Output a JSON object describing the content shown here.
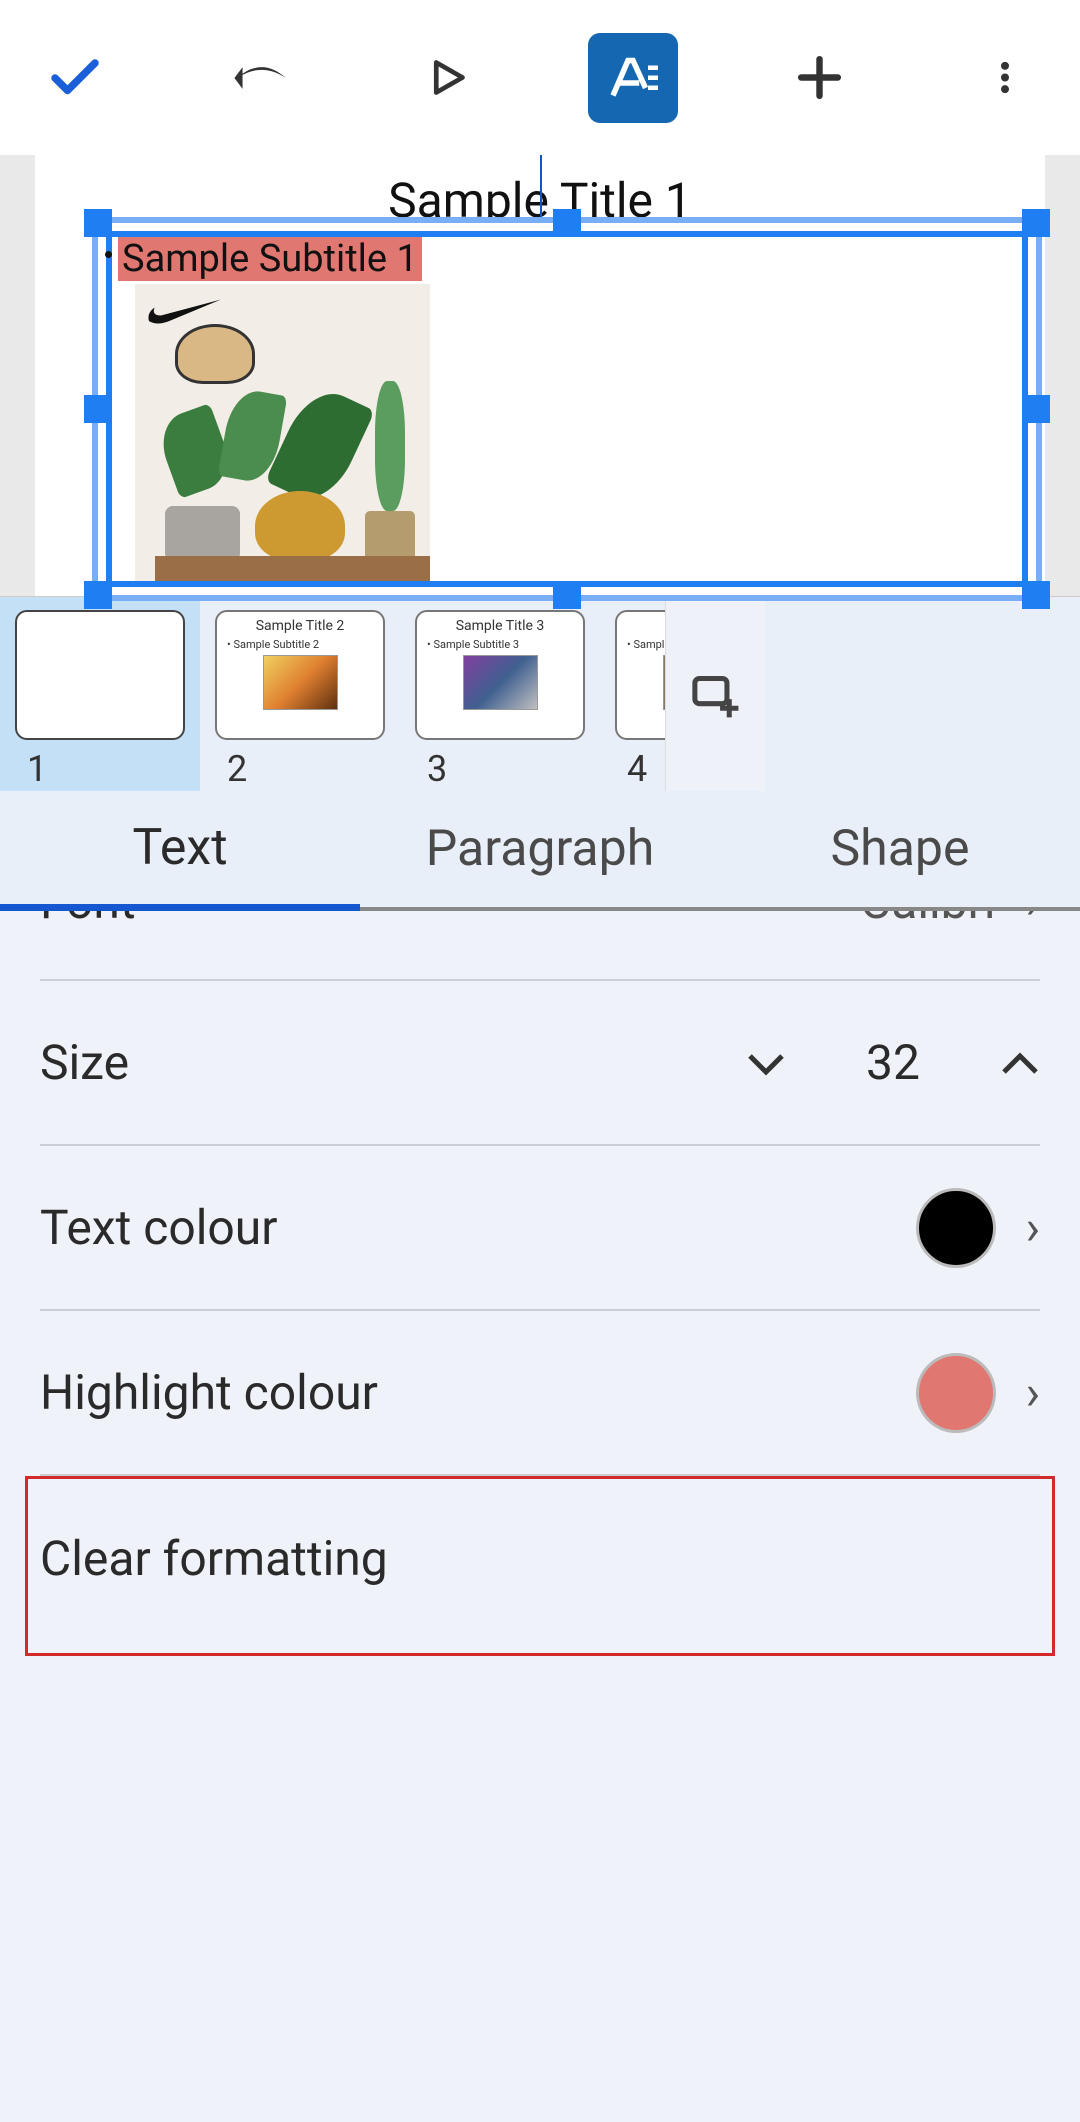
{
  "toolbar": {
    "done_icon": "check",
    "undo_icon": "undo",
    "play_icon": "play",
    "format_icon": "text-format",
    "add_icon": "plus",
    "more_icon": "more-vert"
  },
  "slide": {
    "title": "Sample Title 1",
    "subtitle": "Sample Subtitle 1"
  },
  "thumbs": [
    {
      "num": "1",
      "title": "",
      "subtitle": ""
    },
    {
      "num": "2",
      "title": "Sample Title 2",
      "subtitle": "Sample Subtitle 2"
    },
    {
      "num": "3",
      "title": "Sample Title 3",
      "subtitle": "Sample Subtitle 3"
    },
    {
      "num": "4",
      "title": "S",
      "subtitle": "Sample Subtit"
    }
  ],
  "tabs": {
    "text": "Text",
    "paragraph": "Paragraph",
    "shape": "Shape"
  },
  "panel": {
    "font_label": "Font",
    "font_value": "Calibri",
    "size_label": "Size",
    "size_value": "32",
    "textcolor_label": "Text colour",
    "textcolor_value": "#000000",
    "highlight_label": "Highlight colour",
    "highlight_value": "#e17771",
    "clear_label": "Clear formatting"
  }
}
